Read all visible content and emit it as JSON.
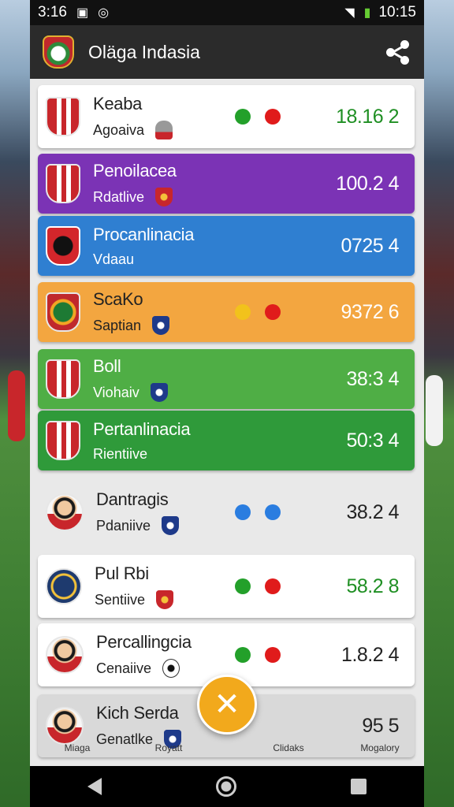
{
  "status": {
    "time": "3:16",
    "clock": "10:15"
  },
  "appbar": {
    "title": "Oläga Indasia"
  },
  "rows": [
    {
      "name": "Keaba",
      "sub": "Agoaiva",
      "score": "18.16 2",
      "bg": "#ffffff",
      "fg": "#222222",
      "score_color": "#1f8f23",
      "badge": "stripe",
      "mini": "cup",
      "dots": [
        "#23a02a",
        "#e01b1b"
      ]
    },
    {
      "name": "Penoilacea",
      "sub": "Rdatlive",
      "score": "100.2 4",
      "bg": "#7b33b5",
      "fg": "#ffffff",
      "score_color": "#ffffff",
      "badge": "stripe",
      "mini": "red",
      "dots": []
    },
    {
      "name": "Procanlinacia",
      "sub": "Vdaau",
      "score": "0725 4",
      "bg": "#2f7fd1",
      "fg": "#ffffff",
      "score_color": "#ffffff",
      "badge": "dark",
      "mini": "",
      "dots": []
    },
    {
      "name": "ScaKo",
      "sub": "Saptian",
      "score": "9372 6",
      "bg": "#f3a640",
      "fg": "#222222",
      "score_color": "#ffffff",
      "badge": "green",
      "mini": "plain",
      "dots": [
        "#f2c21b",
        "#e01b1b"
      ]
    },
    {
      "name": "Boll",
      "sub": "Viohaiv",
      "score": "38:3 4",
      "bg": "#4fae45",
      "fg": "#ffffff",
      "score_color": "#ffffff",
      "badge": "stripe",
      "mini": "plain",
      "dots": []
    },
    {
      "name": "Pertanlinacia",
      "sub": "Rientiive",
      "score": "50:3 4",
      "bg": "#2f9a3a",
      "fg": "#ffffff",
      "score_color": "#ffffff",
      "badge": "stripe",
      "mini": "",
      "dots": []
    },
    {
      "name": "Dantragis",
      "sub": "Pdaniive",
      "score": "38.2 4",
      "bg": "#e9e9e9",
      "fg": "#222222",
      "score_color": "#222222",
      "badge": "round",
      "mini": "plain",
      "dots": [
        "#2a7de0",
        "#2a7de0"
      ]
    },
    {
      "name": "Pul Rbi",
      "sub": "Sentiive",
      "score": "58.2 8",
      "bg": "#ffffff",
      "fg": "#222222",
      "score_color": "#1f8f23",
      "badge": "crest",
      "mini": "red",
      "dots": [
        "#23a02a",
        "#e01b1b"
      ]
    },
    {
      "name": "Percallingcia",
      "sub": "Cenaiive",
      "score": "1.8.2 4",
      "bg": "#ffffff",
      "fg": "#222222",
      "score_color": "#222222",
      "badge": "round",
      "mini": "ball",
      "dots": [
        "#23a02a",
        "#e01b1b"
      ]
    },
    {
      "name": "Kich Serda",
      "sub": "Genatlke",
      "score": "95 5",
      "bg": "#d9d9d9",
      "fg": "#222222",
      "score_color": "#222222",
      "badge": "round",
      "mini": "plain",
      "dots": []
    }
  ],
  "tabs": [
    "Miaga",
    "Royatt",
    "Clidaks",
    "Mogalory"
  ],
  "fab_icon": "close-icon"
}
